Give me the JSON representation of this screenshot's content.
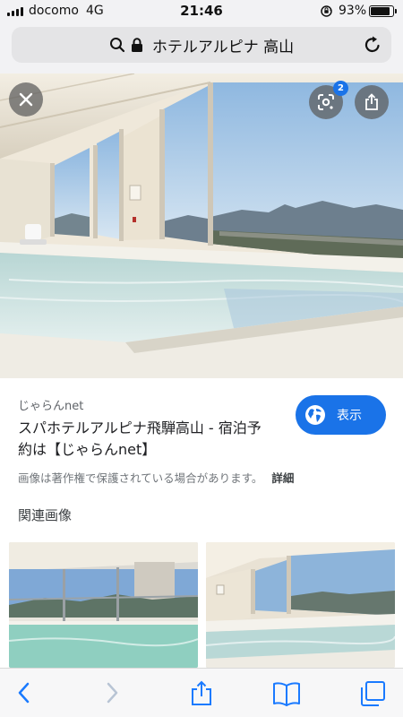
{
  "status_bar": {
    "carrier": "docomo",
    "network": "4G",
    "time": "21:46",
    "battery_percent": "93%",
    "battery_level": 0.93
  },
  "address_bar": {
    "text": "ホテルアルピナ 高山",
    "icons": [
      "search-icon",
      "lock-icon",
      "reload-icon"
    ]
  },
  "viewer": {
    "lens_badge_count": "2",
    "icons": [
      "close-icon",
      "google-lens-icon",
      "share-icon"
    ]
  },
  "result": {
    "source": "じゃらんnet",
    "title_line1": "スパホテルアルピナ飛騨高山 - 宿泊予",
    "title_line2": "約は【じゃらんnet】",
    "open_button_label": "表示",
    "copyright_notice": "画像は著作権で保護されている場合があります。",
    "details_link": "詳細"
  },
  "related": {
    "heading": "関連画像"
  },
  "toolbar": {
    "icons": [
      "back-icon",
      "forward-icon",
      "share-icon",
      "bookmarks-icon",
      "tabs-icon"
    ]
  },
  "colors": {
    "accent": "#1a73e8",
    "chrome_bg": "#f2f2f4",
    "text": "#202124"
  }
}
